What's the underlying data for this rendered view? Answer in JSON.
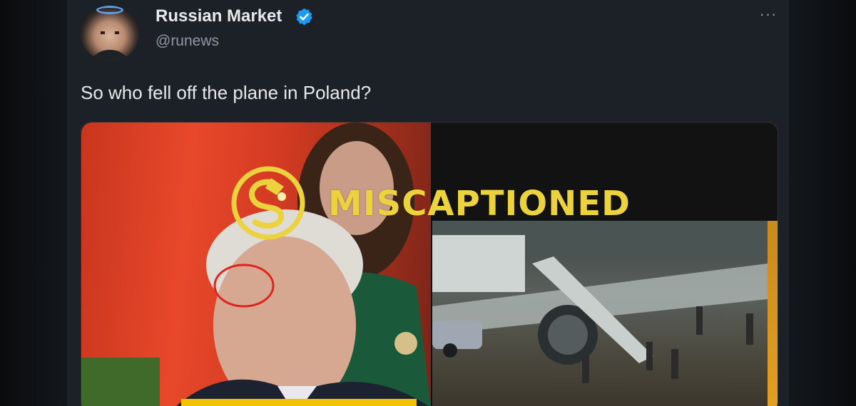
{
  "tweet": {
    "display_name": "Russian Market",
    "handle": "@runews",
    "verified": true,
    "more_icon": "more-options-icon",
    "text": "So who fell off the plane in Poland?",
    "media": {
      "left_photo": "press-conference-photo",
      "right_photo": "airplane-stairs-video-frame"
    }
  },
  "overlay": {
    "label": "MISCAPTIONED",
    "logo_icon": "snopes-logo-icon",
    "color": "#ecd23c"
  },
  "colors": {
    "background": "#1c2127",
    "text": "#e7e9ea",
    "secondary_text": "#8b98a5",
    "verified_badge": "#1d9bf0"
  }
}
